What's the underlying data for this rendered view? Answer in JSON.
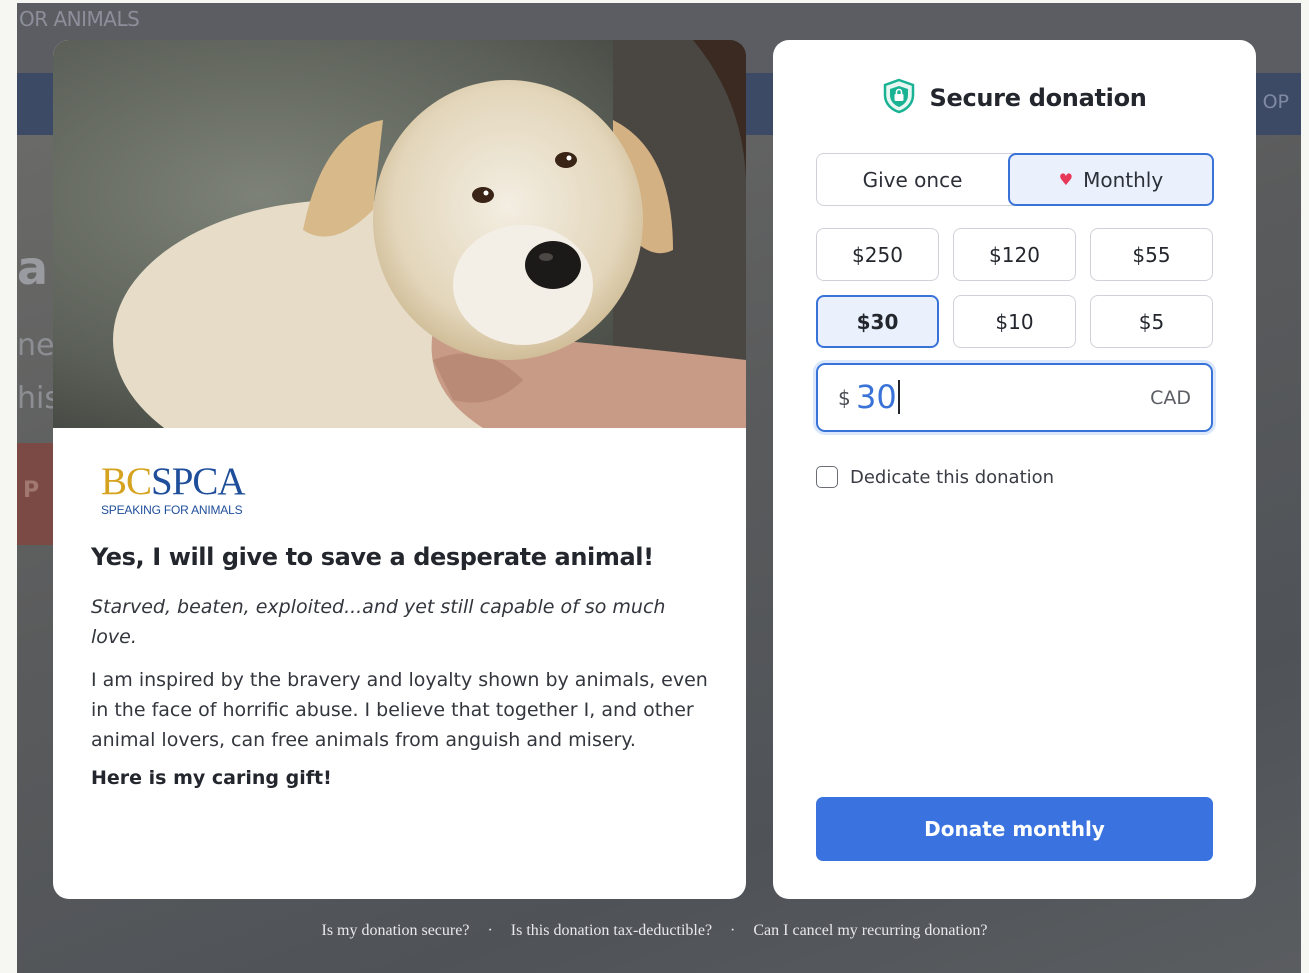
{
  "background_page": {
    "brand_partial": "OR ANIMALS",
    "nav_partial": "OP",
    "hero_partial_1": "a",
    "hero_partial_2": "ne",
    "hero_partial_3": "his",
    "hero_button_partial": "P"
  },
  "story": {
    "logo_bc": "BC",
    "logo_spca": "SPCA",
    "logo_tagline": "SPEAKING FOR ANIMALS",
    "title": "Yes, I will give to save a desperate animal!",
    "lede": "Starved, beaten, exploited...and yet still capable of so much love.",
    "body": "I am inspired by the bravery and loyalty shown by animals, even in the face of horrific abuse. I believe that together I, and other animal lovers, can free animals from anguish and misery.",
    "closing": "Here is my caring gift!"
  },
  "donation": {
    "title": "Secure donation",
    "frequency": {
      "once_label": "Give once",
      "monthly_label": "Monthly",
      "selected": "monthly"
    },
    "amounts": [
      "$250",
      "$120",
      "$55",
      "$30",
      "$10",
      "$5"
    ],
    "selected_amount": "$30",
    "amount_field": {
      "symbol": "$",
      "value": "30",
      "currency": "CAD"
    },
    "dedicate_label": "Dedicate this donation",
    "dedicate_checked": false,
    "submit_label": "Donate monthly"
  },
  "footer": {
    "link_secure": "Is my donation secure?",
    "link_tax": "Is this donation tax-deductible?",
    "link_cancel": "Can I cancel my recurring donation?",
    "separator": "·"
  },
  "colors": {
    "accent": "#3a73e0",
    "selected_bg": "#eaf1fc",
    "heart": "#e8385a",
    "shield": "#19b394",
    "logo_gold": "#d5a31f",
    "logo_blue": "#1f4e9a"
  }
}
